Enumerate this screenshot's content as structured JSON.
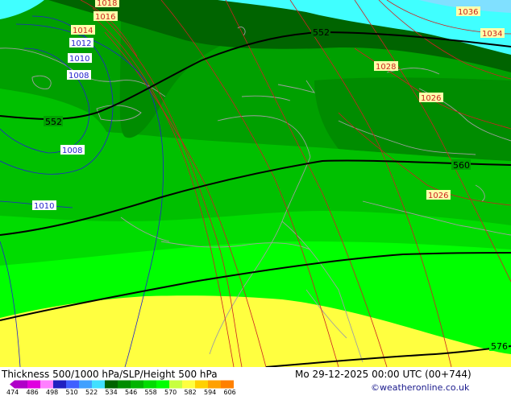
{
  "footer": {
    "title": "Thickness 500/1000 hPa/SLP/Height 500 hPa",
    "datetime": "Mo 29-12-2025 00:00 UTC (00+744)",
    "credit": "©weatheronline.co.uk"
  },
  "legend": {
    "ticks": [
      "474",
      "486",
      "498",
      "510",
      "522",
      "534",
      "546",
      "558",
      "570",
      "582",
      "594",
      "606"
    ],
    "colors": [
      "#b000c8",
      "#e000e0",
      "#ff80ff",
      "#2020c0",
      "#4060ff",
      "#40a0ff",
      "#40e0ff",
      "#006400",
      "#008c00",
      "#00b400",
      "#00dc00",
      "#00ff00",
      "#c8ff40",
      "#ffff40",
      "#ffd000",
      "#ffa000",
      "#ff8000"
    ]
  },
  "map": {
    "colors": {
      "cyan": "#40ffff",
      "light_blue": "#80e0ff",
      "dark_green": "#006400",
      "green_546": "#008c00",
      "green_552": "#00a000",
      "green_558": "#00c000",
      "green_564": "#00dc00",
      "bright_green": "#00ff00",
      "yellow": "#ffff40",
      "isobar_red": "#cc2222",
      "isobar_blue": "#2222cc",
      "height_black": "#000000",
      "coast": "#a0a0a0"
    },
    "height_labels": [
      "552",
      "552",
      "560",
      "576"
    ],
    "isobar_labels_red": [
      "1018",
      "1016",
      "1014",
      "1036",
      "1034",
      "1028",
      "1026",
      "1026"
    ],
    "isobar_labels_blue": [
      "1012",
      "1010",
      "1008",
      "1008",
      "1010"
    ]
  }
}
